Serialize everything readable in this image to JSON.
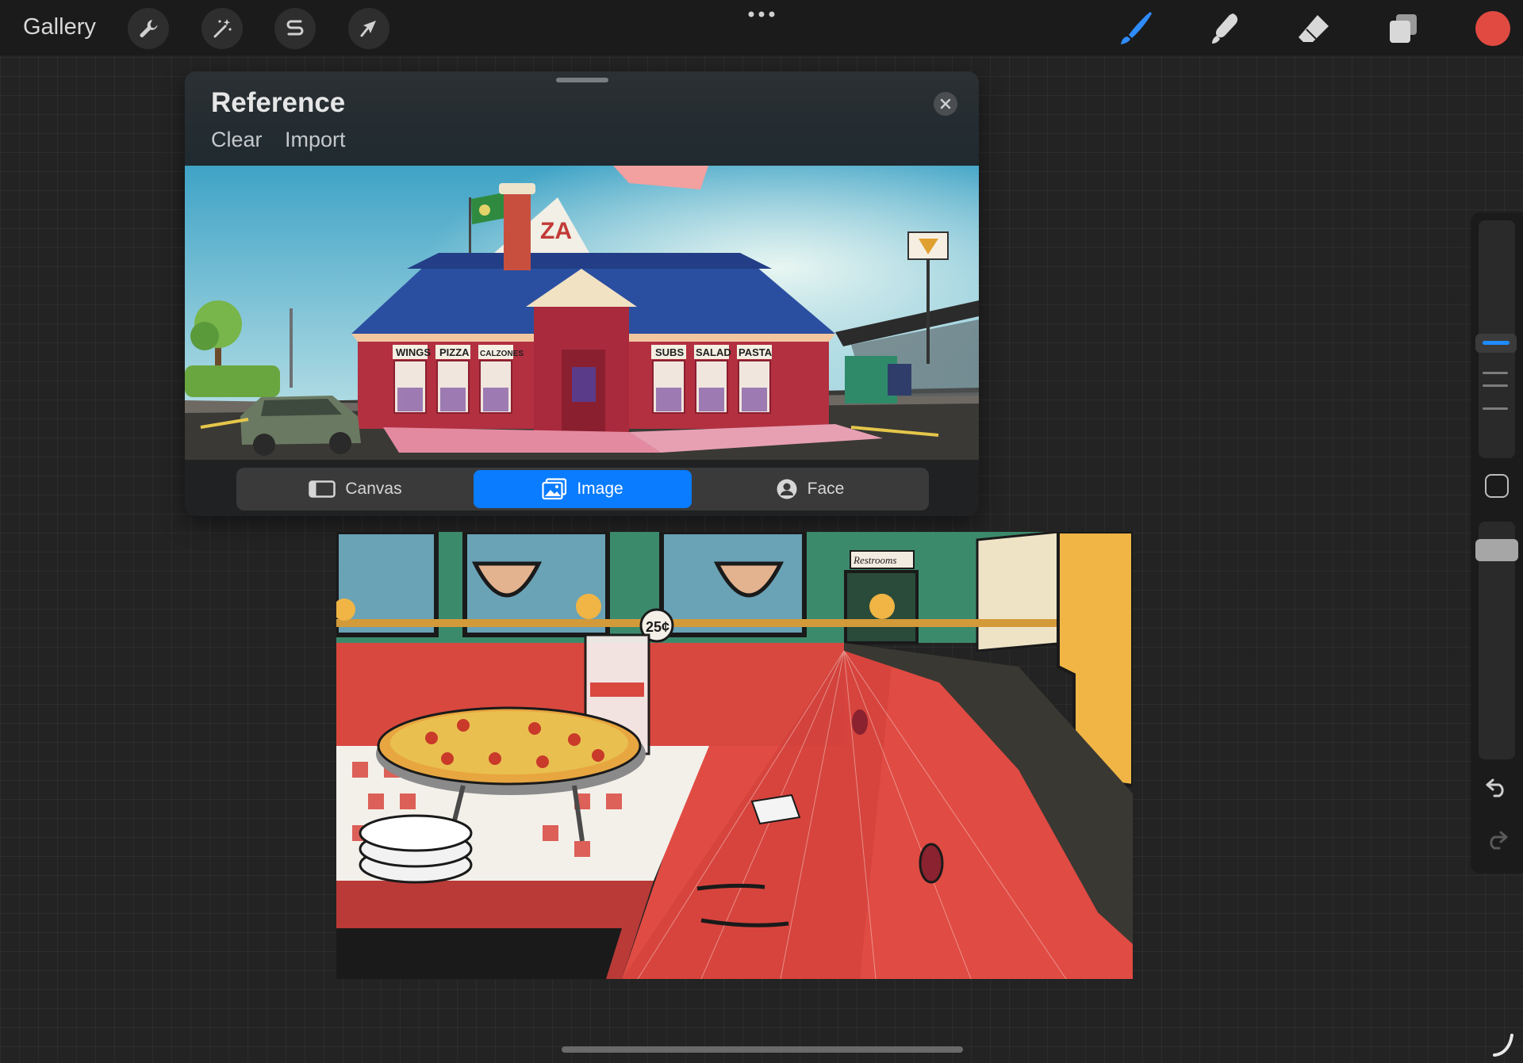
{
  "topbar": {
    "gallery_label": "Gallery",
    "icons": [
      "wrench-icon",
      "magic-wand-icon",
      "selection-s-icon",
      "arrow-transform-icon"
    ],
    "more_icon": "more-dots-icon",
    "right_tools": [
      "brush-icon",
      "smudge-icon",
      "eraser-icon",
      "layers-icon"
    ],
    "current_color": "#e04a41"
  },
  "reference": {
    "title": "Reference",
    "actions": {
      "clear": "Clear",
      "import": "Import"
    },
    "tabs": [
      {
        "label": "Canvas",
        "icon": "canvas-icon",
        "active": false
      },
      {
        "label": "Image",
        "icon": "image-icon",
        "active": true
      },
      {
        "label": "Face",
        "icon": "face-icon",
        "active": false
      }
    ],
    "image": {
      "storefront_signs": [
        "WINGS",
        "PIZZA",
        "CALZONES",
        "SUBS",
        "SALAD",
        "PASTA"
      ],
      "roof_sign": "ZA"
    }
  },
  "canvas": {
    "coin_label": "25¢",
    "restroom_sign": "Restrooms"
  },
  "sidebar": {
    "accent": "#1e8bff"
  }
}
